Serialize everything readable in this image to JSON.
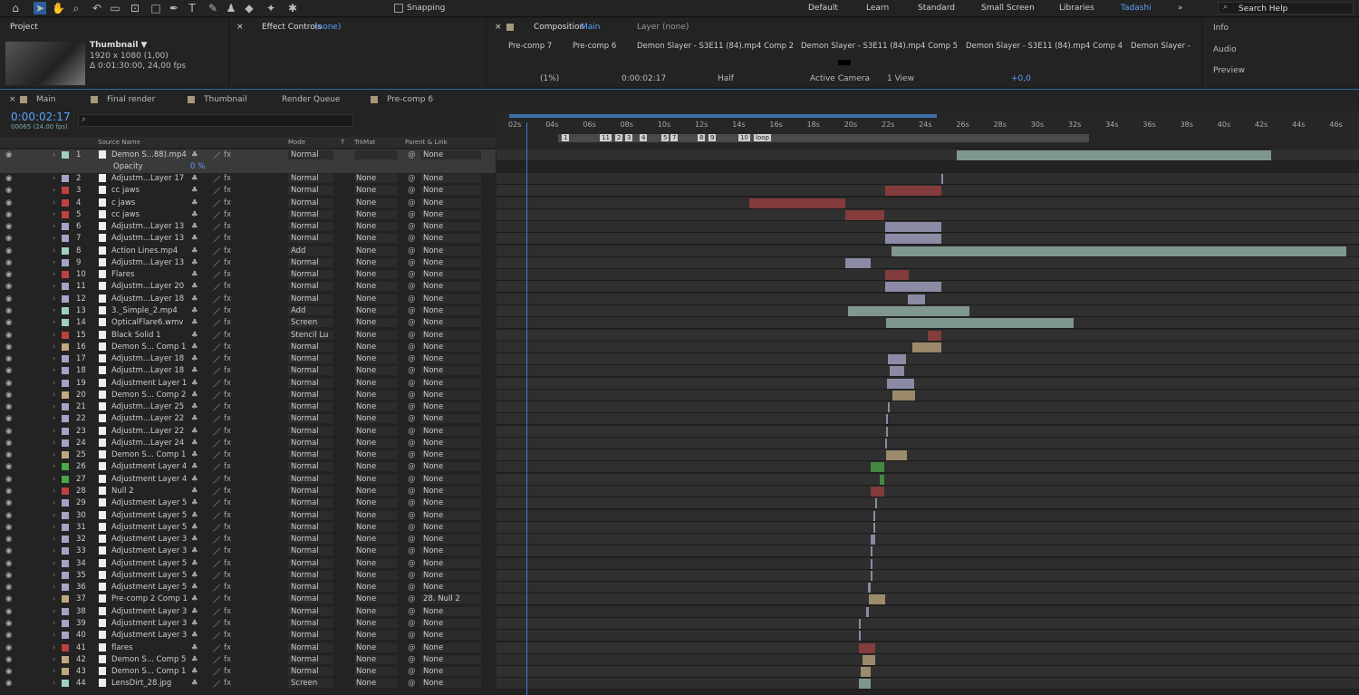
{
  "toolbar": {
    "snapping": "Snapping",
    "workspaces": [
      "Default",
      "Learn",
      "Standard",
      "Small Screen",
      "Libraries",
      "Tadashi"
    ],
    "search_placeholder": "Search Help"
  },
  "project": {
    "tab": "Project",
    "thumb_name": "Thumbnail ▼",
    "thumb_info1": "1920 x 1080 (1,00)",
    "thumb_info2": "Δ 0:01:30:00, 24,00 fps"
  },
  "effect_controls": {
    "tab": "Effect Controls",
    "value": "(none)"
  },
  "composition": {
    "tab": "Composition",
    "name": "Main",
    "layer_tab": "Layer (none)",
    "breadcrumbs": [
      "Pre-comp 7",
      "Pre-comp 6",
      "Demon Slayer - S3E11 (84).mp4 Comp 2",
      "Demon Slayer - S3E11 (84).mp4 Comp 5",
      "Demon Slayer - S3E11 (84).mp4 Comp 4",
      "Demon Slayer -"
    ],
    "zoom": "(1%)",
    "timecode": "0:00:02:17",
    "resolution": "Half",
    "camera": "Active Camera",
    "view": "1 View",
    "exposure": "+0,0"
  },
  "right_panel": {
    "items": [
      "Info",
      "Audio",
      "Preview"
    ]
  },
  "timeline": {
    "tabs": [
      "Main",
      "Final render",
      "Thumbnail",
      "Render Queue",
      "Pre-comp 6"
    ],
    "tab_colors": [
      "#a8987a",
      "#a8987a",
      "#a8987a",
      "#a8987a",
      "#a8987a"
    ],
    "timecode": "0:00:02:17",
    "frames": "00065 (24.00 fps)",
    "col_source": "Source Name",
    "col_mode": "Mode",
    "col_t": "T",
    "col_trkmat": "TrkMat",
    "col_parent": "Parent & Link",
    "opacity_label": "Opacity",
    "opacity_value": "0 %",
    "markers": [
      "1",
      "11",
      "2",
      "3",
      "4",
      "5",
      "7",
      "8",
      "9",
      "10",
      "loop"
    ],
    "ruler": [
      "02s",
      "04s",
      "06s",
      "08s",
      "10s",
      "12s",
      "14s",
      "16s",
      "18s",
      "20s",
      "22s",
      "24s",
      "26s",
      "28s",
      "30s",
      "32s",
      "34s",
      "36s",
      "38s",
      "40s",
      "42s",
      "44s",
      "46s"
    ],
    "layers": [
      {
        "n": "1",
        "name": "Demon S...88).mp4",
        "color": "#9fd0c0",
        "mode": "Normal",
        "trk": "",
        "parent": "None"
      },
      {
        "n": "2",
        "name": "Adjustm...Layer 17",
        "color": "#a4a4c8",
        "mode": "Normal",
        "trk": "None",
        "parent": "None"
      },
      {
        "n": "3",
        "name": "cc jaws",
        "color": "#c04040",
        "mode": "Normal",
        "trk": "None",
        "parent": "None"
      },
      {
        "n": "4",
        "name": "c jaws",
        "color": "#c04040",
        "mode": "Normal",
        "trk": "None",
        "parent": "None"
      },
      {
        "n": "5",
        "name": "cc jaws",
        "color": "#c04040",
        "mode": "Normal",
        "trk": "None",
        "parent": "None"
      },
      {
        "n": "6",
        "name": "Adjustm...Layer 13",
        "color": "#a4a4c8",
        "mode": "Normal",
        "trk": "None",
        "parent": "None"
      },
      {
        "n": "7",
        "name": "Adjustm...Layer 13",
        "color": "#a4a4c8",
        "mode": "Normal",
        "trk": "None",
        "parent": "None"
      },
      {
        "n": "8",
        "name": "Action Lines.mp4",
        "color": "#9fd0c0",
        "mode": "Add",
        "trk": "None",
        "parent": "None"
      },
      {
        "n": "9",
        "name": "Adjustm...Layer 13",
        "color": "#a4a4c8",
        "mode": "Normal",
        "trk": "None",
        "parent": "None"
      },
      {
        "n": "10",
        "name": "Flares",
        "color": "#c04040",
        "mode": "Normal",
        "trk": "None",
        "parent": "None"
      },
      {
        "n": "11",
        "name": "Adjustm...Layer 20",
        "color": "#a4a4c8",
        "mode": "Normal",
        "trk": "None",
        "parent": "None"
      },
      {
        "n": "12",
        "name": "Adjustm...Layer 18",
        "color": "#a4a4c8",
        "mode": "Normal",
        "trk": "None",
        "parent": "None"
      },
      {
        "n": "13",
        "name": "3._Simple_2.mp4",
        "color": "#9fd0c0",
        "mode": "Add",
        "trk": "None",
        "parent": "None"
      },
      {
        "n": "14",
        "name": "OpticalFlare6.wmv",
        "color": "#9fd0c0",
        "mode": "Screen",
        "trk": "None",
        "parent": "None"
      },
      {
        "n": "15",
        "name": "Black Solid 1",
        "color": "#c04040",
        "mode": "Stencil Lu",
        "trk": "None",
        "parent": "None"
      },
      {
        "n": "16",
        "name": "Demon S... Comp 1",
        "color": "#c0a880",
        "mode": "Normal",
        "trk": "None",
        "parent": "None"
      },
      {
        "n": "17",
        "name": "Adjustm...Layer 18",
        "color": "#a4a4c8",
        "mode": "Normal",
        "trk": "None",
        "parent": "None"
      },
      {
        "n": "18",
        "name": "Adjustm...Layer 18",
        "color": "#a4a4c8",
        "mode": "Normal",
        "trk": "None",
        "parent": "None"
      },
      {
        "n": "19",
        "name": "Adjustment Layer 1",
        "color": "#a4a4c8",
        "mode": "Normal",
        "trk": "None",
        "parent": "None"
      },
      {
        "n": "20",
        "name": "Demon S... Comp 2",
        "color": "#c0a880",
        "mode": "Normal",
        "trk": "None",
        "parent": "None"
      },
      {
        "n": "21",
        "name": "Adjustm...Layer 25",
        "color": "#a4a4c8",
        "mode": "Normal",
        "trk": "None",
        "parent": "None"
      },
      {
        "n": "22",
        "name": "Adjustm...Layer 22",
        "color": "#a4a4c8",
        "mode": "Normal",
        "trk": "None",
        "parent": "None"
      },
      {
        "n": "23",
        "name": "Adjustm...Layer 22",
        "color": "#a4a4c8",
        "mode": "Normal",
        "trk": "None",
        "parent": "None"
      },
      {
        "n": "24",
        "name": "Adjustm...Layer 24",
        "color": "#a4a4c8",
        "mode": "Normal",
        "trk": "None",
        "parent": "None"
      },
      {
        "n": "25",
        "name": "Demon S... Comp 1",
        "color": "#c0a880",
        "mode": "Normal",
        "trk": "None",
        "parent": "None"
      },
      {
        "n": "26",
        "name": "Adjustment Layer 4",
        "color": "#4aa84a",
        "mode": "Normal",
        "trk": "None",
        "parent": "None"
      },
      {
        "n": "27",
        "name": "Adjustment Layer 4",
        "color": "#4aa84a",
        "mode": "Normal",
        "trk": "None",
        "parent": "None"
      },
      {
        "n": "28",
        "name": "Null 2",
        "color": "#c04040",
        "mode": "Normal",
        "trk": "None",
        "parent": "None"
      },
      {
        "n": "29",
        "name": "Adjustment Layer 5",
        "color": "#a4a4c8",
        "mode": "Normal",
        "trk": "None",
        "parent": "None"
      },
      {
        "n": "30",
        "name": "Adjustment Layer 5",
        "color": "#a4a4c8",
        "mode": "Normal",
        "trk": "None",
        "parent": "None"
      },
      {
        "n": "31",
        "name": "Adjustment Layer 5",
        "color": "#a4a4c8",
        "mode": "Normal",
        "trk": "None",
        "parent": "None"
      },
      {
        "n": "32",
        "name": "Adjustment Layer 3",
        "color": "#a4a4c8",
        "mode": "Normal",
        "trk": "None",
        "parent": "None"
      },
      {
        "n": "33",
        "name": "Adjustment Layer 3",
        "color": "#a4a4c8",
        "mode": "Normal",
        "trk": "None",
        "parent": "None"
      },
      {
        "n": "34",
        "name": "Adjustment Layer 5",
        "color": "#a4a4c8",
        "mode": "Normal",
        "trk": "None",
        "parent": "None"
      },
      {
        "n": "35",
        "name": "Adjustment Layer 5",
        "color": "#a4a4c8",
        "mode": "Normal",
        "trk": "None",
        "parent": "None"
      },
      {
        "n": "36",
        "name": "Adjustment Layer 5",
        "color": "#a4a4c8",
        "mode": "Normal",
        "trk": "None",
        "parent": "None"
      },
      {
        "n": "37",
        "name": "Pre-comp 2 Comp 1",
        "color": "#c0a880",
        "mode": "Normal",
        "trk": "None",
        "parent": "28. Null 2"
      },
      {
        "n": "38",
        "name": "Adjustment Layer 3",
        "color": "#a4a4c8",
        "mode": "Normal",
        "trk": "None",
        "parent": "None"
      },
      {
        "n": "39",
        "name": "Adjustment Layer 3",
        "color": "#a4a4c8",
        "mode": "Normal",
        "trk": "None",
        "parent": "None"
      },
      {
        "n": "40",
        "name": "Adjustment Layer 3",
        "color": "#a4a4c8",
        "mode": "Normal",
        "trk": "None",
        "parent": "None"
      },
      {
        "n": "41",
        "name": "flares",
        "color": "#c04040",
        "mode": "Normal",
        "trk": "None",
        "parent": "None"
      },
      {
        "n": "42",
        "name": "Demon S... Comp 5",
        "color": "#c0a880",
        "mode": "Normal",
        "trk": "None",
        "parent": "None"
      },
      {
        "n": "43",
        "name": "Demon S... Comp 1",
        "color": "#c0a880",
        "mode": "Normal",
        "trk": "None",
        "parent": "None"
      },
      {
        "n": "44",
        "name": "LensDirt_28.jpg",
        "color": "#9fd0c0",
        "mode": "Screen",
        "trk": "None",
        "parent": "None"
      }
    ]
  }
}
